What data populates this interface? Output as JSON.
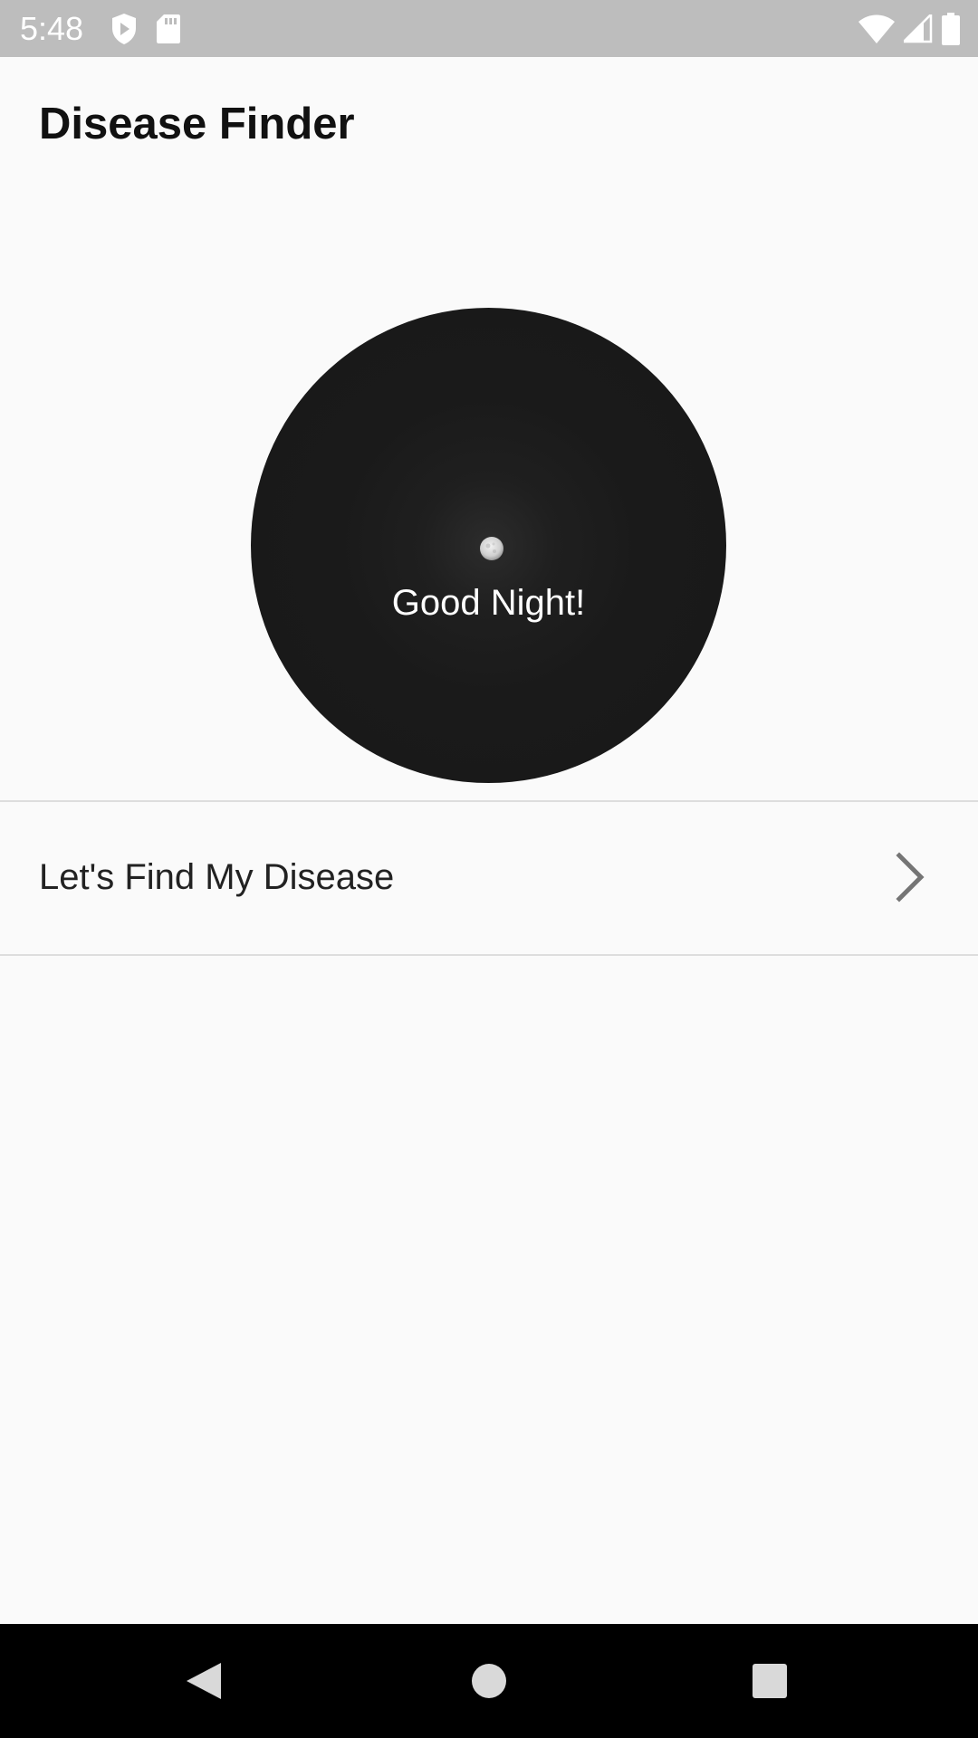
{
  "status_bar": {
    "time": "5:48",
    "left_icons": [
      "shield-play-icon",
      "sd-card-icon"
    ],
    "right_icons": [
      "wifi-icon",
      "cell-signal-icon",
      "battery-icon"
    ],
    "background_color": "#bdbdbd"
  },
  "app": {
    "title": "Disease Finder"
  },
  "greeting": {
    "text": "Good Night!",
    "icon": "moon-icon",
    "background_color": "#1a1a1a"
  },
  "menu": {
    "items": [
      {
        "label": "Let's Find My Disease",
        "icon": "chevron-right-icon"
      }
    ]
  },
  "nav_bar": {
    "buttons": [
      "back-icon",
      "home-icon",
      "recents-icon"
    ],
    "background_color": "#000000"
  }
}
